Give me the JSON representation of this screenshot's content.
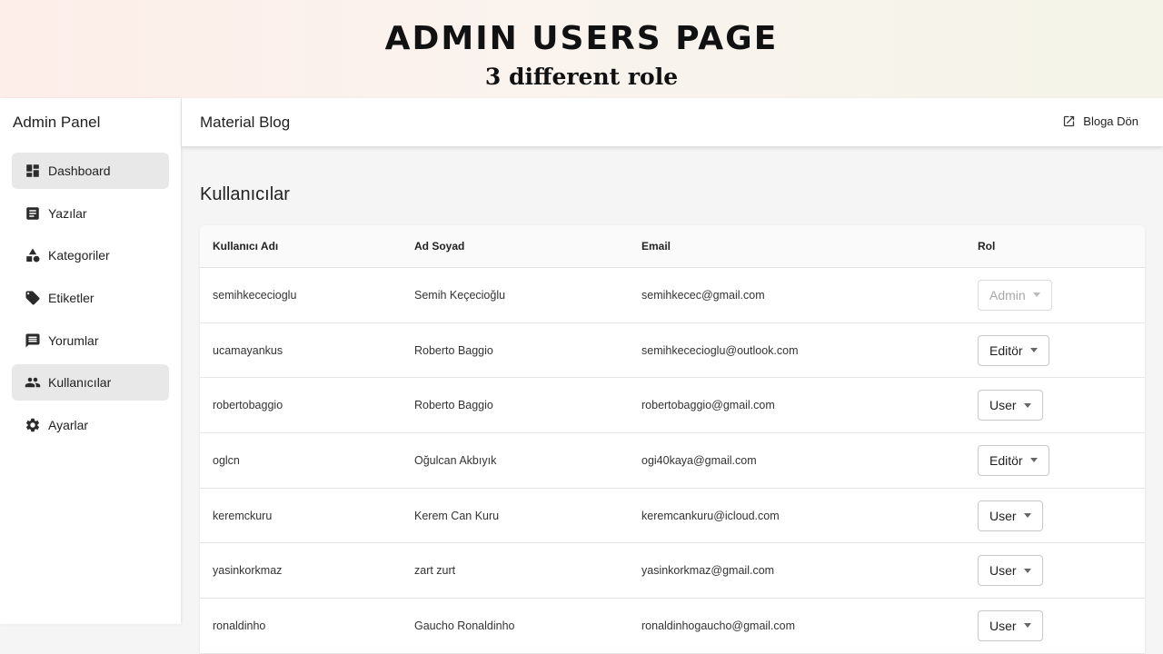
{
  "banner": {
    "title": "ADMIN USERS PAGE",
    "subtitle": "3 different role"
  },
  "sidebar": {
    "title": "Admin Panel",
    "items": [
      {
        "label": "Dashboard",
        "icon": "dashboard-icon",
        "active": true
      },
      {
        "label": "Yazılar",
        "icon": "article-icon",
        "active": false
      },
      {
        "label": "Kategoriler",
        "icon": "category-icon",
        "active": false
      },
      {
        "label": "Etiketler",
        "icon": "tag-icon",
        "active": false
      },
      {
        "label": "Yorumlar",
        "icon": "comment-icon",
        "active": false
      },
      {
        "label": "Kullanıcılar",
        "icon": "people-icon",
        "active": true
      },
      {
        "label": "Ayarlar",
        "icon": "gear-icon",
        "active": false
      }
    ]
  },
  "appbar": {
    "title": "Material Blog",
    "back_label": "Bloga Dön",
    "back_icon": "open-in-new-icon"
  },
  "page": {
    "title": "Kullanıcılar"
  },
  "table": {
    "headers": [
      "Kullanıcı Adı",
      "Ad Soyad",
      "Email",
      "Rol"
    ],
    "rows": [
      {
        "username": "semihkececioglu",
        "name": "Semih Keçecioğlu",
        "email": "semihkecec@gmail.com",
        "role": "Admin",
        "disabled": true
      },
      {
        "username": "ucamayankus",
        "name": "Roberto Baggio",
        "email": "semihkececioglu@outlook.com",
        "role": "Editör",
        "disabled": false
      },
      {
        "username": "robertobaggio",
        "name": "Roberto Baggio",
        "email": "robertobaggio@gmail.com",
        "role": "User",
        "disabled": false
      },
      {
        "username": "oglcn",
        "name": "Oğulcan Akbıyık",
        "email": "ogi40kaya@gmail.com",
        "role": "Editör",
        "disabled": false
      },
      {
        "username": "keremckuru",
        "name": "Kerem Can Kuru",
        "email": "keremcankuru@icloud.com",
        "role": "User",
        "disabled": false
      },
      {
        "username": "yasinkorkmaz",
        "name": "zart zurt",
        "email": "yasinkorkmaz@gmail.com",
        "role": "User",
        "disabled": false
      },
      {
        "username": "ronaldinho",
        "name": "Gaucho Ronaldinho",
        "email": "ronaldinhogaucho@gmail.com",
        "role": "User",
        "disabled": false
      }
    ]
  }
}
